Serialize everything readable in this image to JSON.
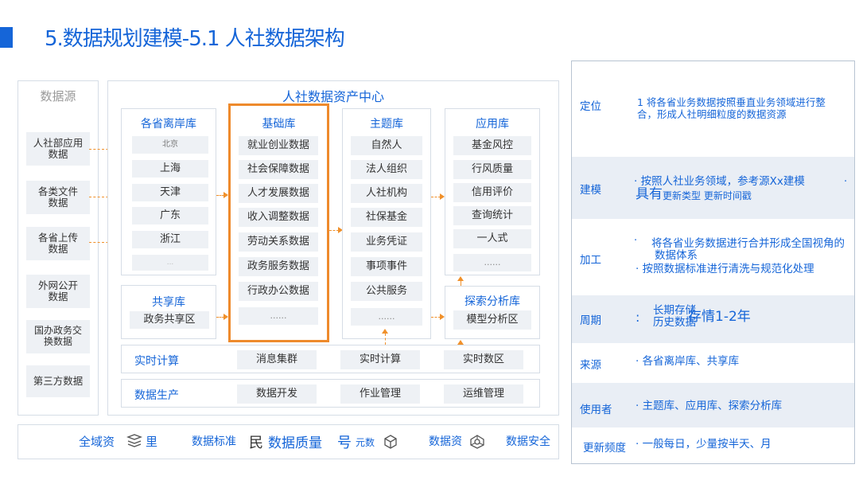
{
  "title": "5.数据规划建模-5.1 人社数据架构",
  "source": {
    "header": "数据源",
    "items": [
      "人社部应用数据",
      "各类文件数据",
      "各省上传数据",
      "外网公开数据",
      "国办政务交换数据",
      "第三方数据"
    ]
  },
  "center": {
    "title": "人社数据资产中心",
    "provincial": {
      "header": "各省离岸库",
      "items": [
        "北京",
        "上海",
        "天津",
        "广东",
        "浙江",
        "..."
      ]
    },
    "shared": {
      "header": "共享库",
      "items": [
        "政务共享区"
      ]
    },
    "base": {
      "header": "基础库",
      "items": [
        "就业创业数据",
        "社会保障数据",
        "人才发展数据",
        "收入调整数据",
        "劳动关系数据",
        "政务服务数据",
        "行政办公数据",
        "......"
      ]
    },
    "theme": {
      "header": "主题库",
      "items": [
        "自然人",
        "法人组织",
        "人社机构",
        "社保基金",
        "业务凭证",
        "事项事件",
        "公共服务",
        "......"
      ]
    },
    "app": {
      "header": "应用库",
      "items": [
        "基金风控",
        "行风质量",
        "信用评价",
        "查询统计",
        "一人式",
        "......"
      ]
    },
    "explore": {
      "header": "探索分析库",
      "items": [
        "模型分析区"
      ]
    },
    "realtime": {
      "label": "实时计算",
      "items": [
        "消息集群",
        "实时计算",
        "实时数区"
      ]
    },
    "production": {
      "label": "数据生产",
      "items": [
        "数据开发",
        "作业管理",
        "运维管理"
      ]
    }
  },
  "bottom_bar": {
    "items": [
      "全域资",
      "里",
      "数据标准",
      "民",
      "数据质量",
      "号",
      "元数",
      "数据资",
      "数据安全"
    ]
  },
  "info": {
    "rows": [
      {
        "label": "定位",
        "lines": [
          "1  将各省业务数据按照垂直业务领域进行整",
          "合，形成人社明细粒度的数据资源"
        ]
      },
      {
        "label": "建模",
        "lines": [
          "·  按照人社业务领域，参考源Xx建模",
          "具有",
          "更新类型   更新时间戳"
        ]
      },
      {
        "label": "加工",
        "lines": [
          "将各省业务数据进行合并形成全国视角的",
          "数据体系",
          "·  按照数据标准进行清洗与规范化处理"
        ]
      },
      {
        "label": "周期",
        "lines": [
          "长期存储",
          "历史数据",
          "存情1-2年"
        ]
      },
      {
        "label": "来源",
        "lines": [
          "·  各省离岸库、共享库"
        ]
      },
      {
        "label": "使用者",
        "lines": [
          "·  主题库、应用库、探索分析库"
        ]
      },
      {
        "label": "更新频度",
        "lines": [
          "·  一般每日，少量按半天、月"
        ]
      }
    ]
  },
  "colors": {
    "accent": "#1565d8",
    "highlight": "#ee8a2c",
    "cell_bg": "#eef1f5"
  }
}
